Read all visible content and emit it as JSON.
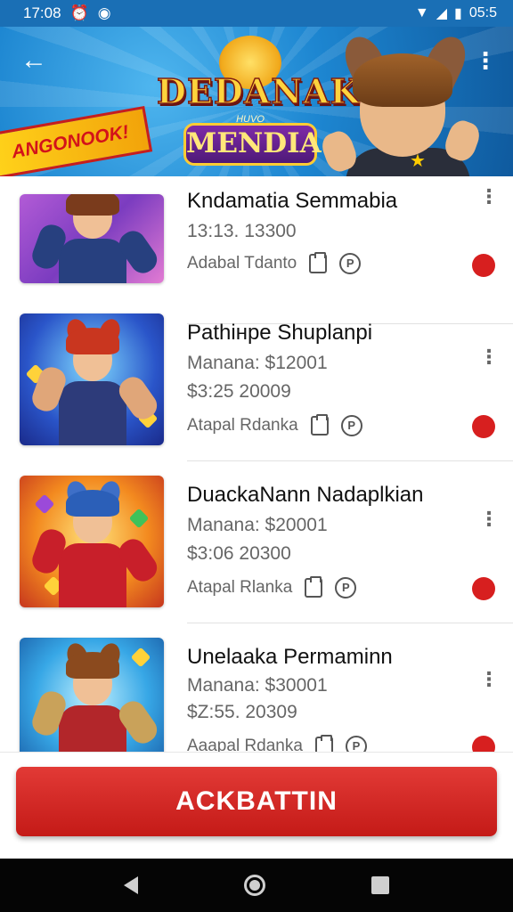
{
  "status_bar": {
    "time": "17:08",
    "battery_text": "05:5",
    "icons": [
      "alarm-icon",
      "shield-icon",
      "wifi-icon",
      "signal-icon",
      "battery-icon"
    ]
  },
  "header": {
    "logo_line1": "DEDANAK",
    "logo_small": "HUVO",
    "logo_line2": "MENDIA",
    "ribbon_text": "ANGONOOK!",
    "back_icon": "arrow-left-icon",
    "menu_icon": "more-vert-icon",
    "colors": {
      "banner": "#1d86d1",
      "ribbon": "#ffd21a",
      "ribbon_text": "#d3121a"
    }
  },
  "items": [
    {
      "title": "Kndamatia Semmabia",
      "line1": "13:13. 13300",
      "line2": "",
      "meta_text": "Adabal Tdanto",
      "palette": {
        "bg": "linear-gradient(135deg,#b25bd6,#7b3cc0,#e27bd3)",
        "hair": "#7a3b1c",
        "torso": "#27407f",
        "arm": "#27407f",
        "ear": "transparent"
      }
    },
    {
      "title": "Pathінpe Shuplanpi",
      "line1": "Manana: $12001",
      "line2": "$3:25  20009",
      "meta_text": "Atapal Rdanka",
      "palette": {
        "bg": "radial-gradient(circle at 50% 40%,#7fd9ff,#2a55c9 60%,#1a2a8a)",
        "hair": "#c9361f",
        "torso": "#2d3b7a",
        "arm": "#e0a679",
        "ear": "#c9361f"
      }
    },
    {
      "title": "DuackaNann Nadaplkian",
      "line1": "Manana: $20001",
      "line2": "$3:06  20300",
      "meta_text": "Atapal  Rlanka",
      "palette": {
        "bg": "radial-gradient(circle at 50% 45%,#ffe27a,#f38a1f 55%,#c6361e)",
        "hair": "#2b5fb8",
        "torso": "#c81f2a",
        "arm": "#c81f2a",
        "ear": "#3e6fc7"
      }
    },
    {
      "title": "Unelaaka Permaminn",
      "line1": "Manana: $30001",
      "line2": "$Z:55. 20309",
      "meta_text": "Aaapal Rdanka",
      "palette": {
        "bg": "radial-gradient(circle at 50% 45%,#bff0ff,#37a7e6 55%,#1a5fa8)",
        "hair": "#8b4a1e",
        "torso": "#b2262a",
        "arm": "#c9a25a",
        "ear": "#8b4a1e"
      }
    }
  ],
  "primary_action": {
    "label": "ACKBATTIN",
    "color": "#d42a26"
  },
  "nav": {
    "back_icon": "nav-back-icon",
    "home_icon": "nav-home-icon",
    "recents_icon": "nav-recents-icon"
  }
}
